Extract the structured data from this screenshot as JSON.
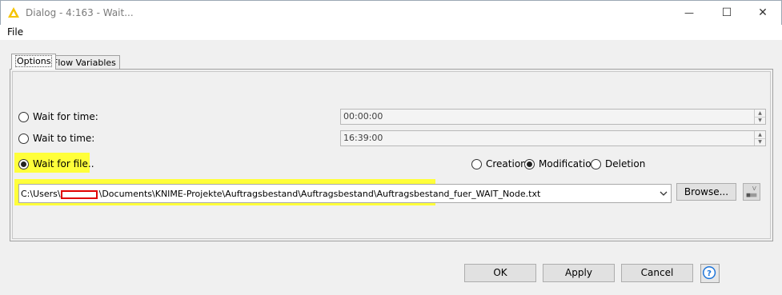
{
  "window": {
    "title": "Dialog - 4:163 - Wait...",
    "minimize_symbol": "—",
    "maximize_symbol": "☐",
    "close_symbol": "✕"
  },
  "menu": {
    "file": "File"
  },
  "tabs": {
    "options": "Options",
    "flow_variables": "Flow Variables"
  },
  "options": {
    "wait_for_time": {
      "label": "Wait for time:",
      "value": "00:00:00",
      "selected": false
    },
    "wait_to_time": {
      "label": "Wait to time:",
      "value": "16:39:00",
      "selected": false
    },
    "wait_for_file": {
      "label": "Wait for file..",
      "selected": true
    },
    "file_events": [
      {
        "label": "Creation",
        "selected": false
      },
      {
        "label": "Modification",
        "selected": true
      },
      {
        "label": "Deletion",
        "selected": false
      }
    ],
    "file_path": {
      "prefix": "C:\\Users\\",
      "suffix": "\\Documents\\KNIME-Projekte\\Auftragsbestand\\Auftragsbestand\\Auftragsbestand_fuer_WAIT_Node.txt"
    },
    "browse_label": "Browse..."
  },
  "buttons": {
    "ok": "OK",
    "apply": "Apply",
    "cancel": "Cancel",
    "help": "?"
  },
  "colors": {
    "highlight": "#ffff3a",
    "redaction": "#e00000",
    "help_accent": "#1a73d9",
    "knime_icon": "#f5c400"
  },
  "icons": {
    "app": "knime-triangle-icon",
    "help": "help-icon",
    "flow_variable": "flow-variable-icon"
  }
}
